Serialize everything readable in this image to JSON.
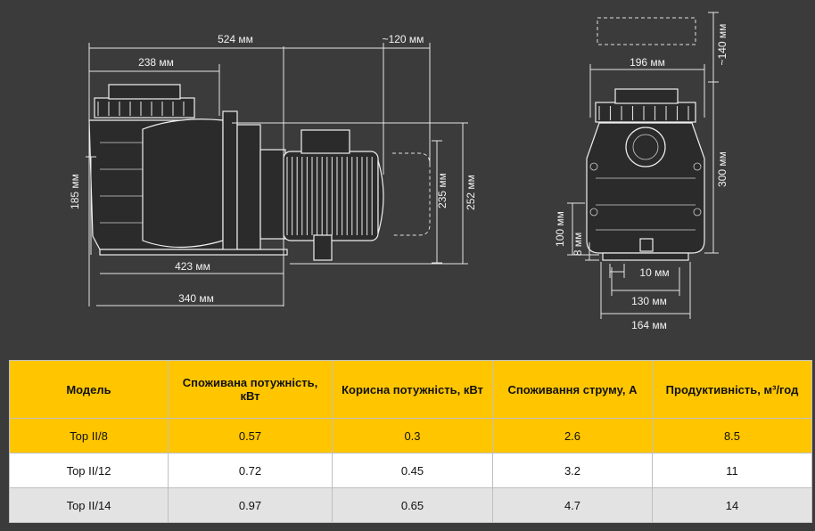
{
  "dimensions": {
    "side_view": {
      "overall_length": "524 мм",
      "motor_clearance": "~120 мм",
      "inlet_offset": "238 мм",
      "inlet_height": "185 мм",
      "motor_height": "235 мм",
      "total_height": "252 мм",
      "base_length": "423 мм",
      "foot_length": "340 мм"
    },
    "front_view": {
      "lid_clearance": "~140 мм",
      "width": "196 мм",
      "height": "300 мм",
      "outlet_height": "100 мм",
      "foot_height": "8 мм",
      "foot_width": "10 мм",
      "foot_spacing": "130 мм",
      "base_width": "164 мм"
    }
  },
  "table": {
    "headers": [
      "Модель",
      "Споживана потужність, кВт",
      "Корисна потужність, кВт",
      "Споживання струму, А",
      "Продуктивність, м³/год"
    ],
    "rows": [
      [
        "Top II/8",
        "0.57",
        "0.3",
        "2.6",
        "8.5"
      ],
      [
        "Top II/12",
        "0.72",
        "0.45",
        "3.2",
        "11"
      ],
      [
        "Top II/14",
        "0.97",
        "0.65",
        "4.7",
        "14"
      ]
    ]
  },
  "colors": {
    "background": "#3b3b3b",
    "header_yellow": "#ffc600",
    "row_white": "#ffffff",
    "row_grey": "#e3e3e3"
  }
}
